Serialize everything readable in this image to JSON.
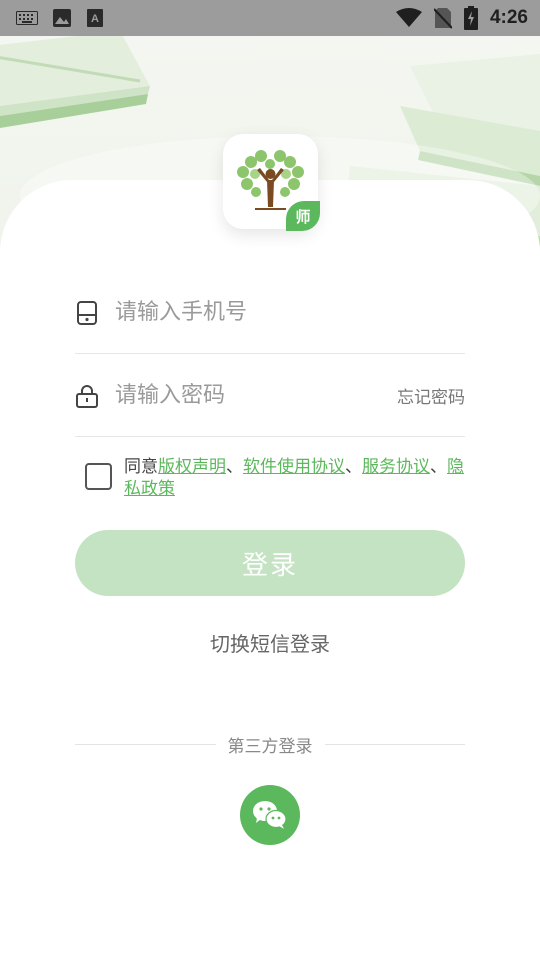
{
  "status_bar": {
    "time": "4:26",
    "icons_left": [
      "keyboard-icon",
      "image-icon",
      "font-icon"
    ],
    "icons_right": [
      "wifi-icon",
      "no-sim-icon",
      "battery-charging-icon"
    ]
  },
  "logo": {
    "badge": "师",
    "icon": "tree-logo-icon"
  },
  "form": {
    "phone_placeholder": "请输入手机号",
    "password_placeholder": "请输入密码",
    "forgot_password": "忘记密码"
  },
  "agreement": {
    "prefix": "同意",
    "sep1": "、",
    "sep2": "、",
    "sep3": "、",
    "links": [
      "版权声明",
      "软件使用协议",
      "服务协议",
      "隐私政策"
    ]
  },
  "login_button": "登录",
  "switch_sms": "切换短信登录",
  "third_party": {
    "label": "第三方登录",
    "icon": "wechat-icon"
  },
  "colors": {
    "accent": "#5cb85c",
    "button_disabled": "#c3e3c3",
    "status_bar": "#9c9c9c"
  }
}
